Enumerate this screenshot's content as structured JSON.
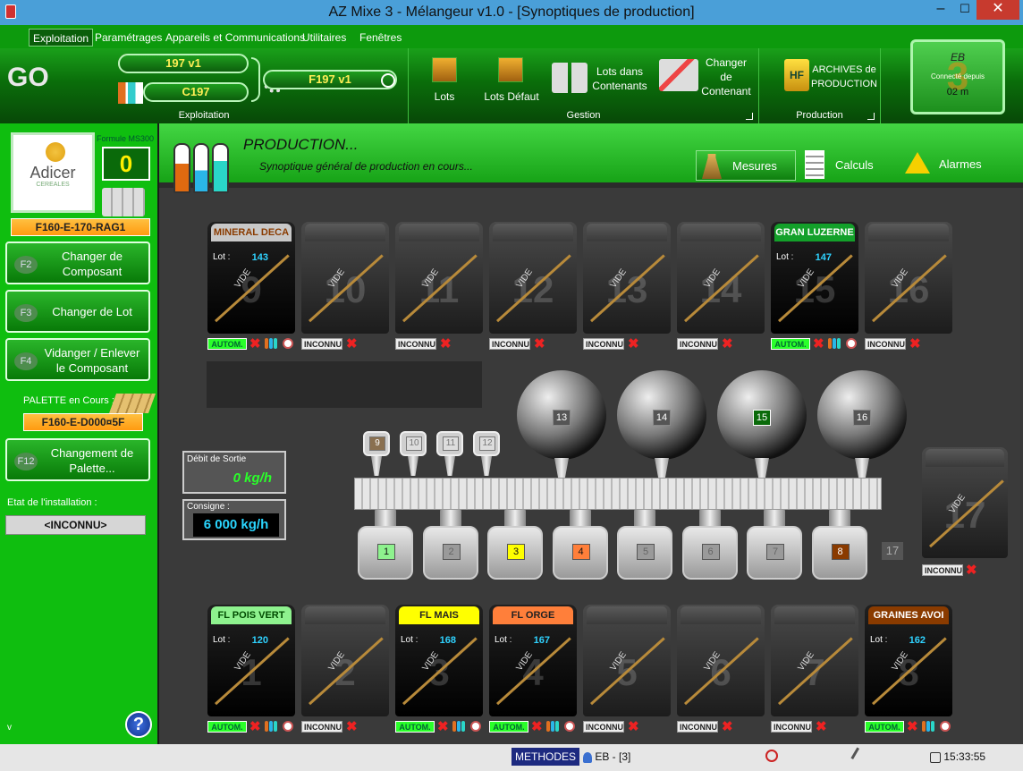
{
  "window": {
    "title": "AZ Mixe 3 -  Mélangeur v1.0 - [Synoptiques de production]",
    "minimize": "–",
    "maximize": "☐",
    "close": "✕"
  },
  "menu": [
    "Exploitation",
    "Paramétrages",
    "Appareils et Communications",
    "Utilitaires",
    "Fenêtres"
  ],
  "ribbon": {
    "go": "GO",
    "pill1": "197 v1",
    "pill2": "C197",
    "pill3": "F197 v1",
    "exploitation_label": "Exploitation",
    "gestion_label": "Gestion",
    "production_label": "Production",
    "lots": "Lots",
    "lots_defaut": "Lots Défaut",
    "lots_contenants": "Lots dans\nContenants",
    "changer_contenant": "Changer\nde\nContenant",
    "archives": "ARCHIVES de\nPRODUCTION",
    "hf": "HF",
    "eb": "EB",
    "connecte": "Connecté depuis",
    "duree": "02 m",
    "eb_num": "3"
  },
  "sidebar": {
    "logo": "Adicer",
    "logo_sub": "CEREALES",
    "formule_label": "Formule MS300",
    "formule_value": "0",
    "recipe": "F160-E-170-RAG1",
    "f2_key": "F2",
    "f2": "Changer de Composant",
    "f3_key": "F3",
    "f3": "Changer de Lot",
    "f4_key": "F4",
    "f4": "Vidanger / Enlever le Composant",
    "palette_label": "PALETTE en Cours :",
    "palette_value": "F160-E-D000¤5F",
    "f12_key": "F12",
    "f12": "Changement de Palette...",
    "etat_label": "Etat de l'installation :",
    "etat_value": "<INCONNU>",
    "version": "v",
    "help": "?"
  },
  "header": {
    "title": "PRODUCTION...",
    "subtitle": "Synoptique général de production en cours...",
    "mesures": "Mesures",
    "calculs": "Calculs",
    "alarmes": "Alarmes"
  },
  "debit": {
    "label": "Débit de Sortie",
    "value": "0 kg/h"
  },
  "consigne": {
    "label": "Consigne :",
    "value": "6 000 kg/h"
  },
  "top_silos": [
    {
      "num": "9",
      "name": "MINERAL DECA",
      "cap": "#c8c8c8",
      "capfg": "#8a3b00",
      "lot": "143",
      "status": "AUTOM."
    },
    {
      "num": "10",
      "name": "",
      "lot": "",
      "status": "INCONNU"
    },
    {
      "num": "11",
      "name": "",
      "lot": "",
      "status": "INCONNU"
    },
    {
      "num": "12",
      "name": "",
      "lot": "",
      "status": "INCONNU"
    },
    {
      "num": "13",
      "name": "",
      "lot": "",
      "status": "INCONNU"
    },
    {
      "num": "14",
      "name": "",
      "lot": "",
      "status": "INCONNU"
    },
    {
      "num": "15",
      "name": "GRAN LUZERNE",
      "cap": "#13a02a",
      "capfg": "#ffffff",
      "lot": "147",
      "status": "AUTOM."
    },
    {
      "num": "16",
      "name": "",
      "lot": "",
      "status": "INCONNU"
    }
  ],
  "bottom_silos": [
    {
      "num": "1",
      "name": "FL POIS VERT",
      "cap": "#8ef28e",
      "capfg": "#004a00",
      "lot": "120",
      "status": "AUTOM."
    },
    {
      "num": "2",
      "name": "",
      "lot": "",
      "status": "INCONNU"
    },
    {
      "num": "3",
      "name": "FL MAIS",
      "cap": "#ffff00",
      "capfg": "#222222",
      "lot": "168",
      "status": "AUTOM."
    },
    {
      "num": "4",
      "name": "FL ORGE",
      "cap": "#ff7f3a",
      "capfg": "#222222",
      "lot": "167",
      "status": "AUTOM."
    },
    {
      "num": "5",
      "name": "",
      "lot": "",
      "status": "INCONNU"
    },
    {
      "num": "6",
      "name": "",
      "lot": "",
      "status": "INCONNU"
    },
    {
      "num": "7",
      "name": "",
      "lot": "",
      "status": "INCONNU"
    },
    {
      "num": "8",
      "name": "GRAINES AVOI",
      "cap": "#8a3b00",
      "capfg": "#ffffff",
      "lot": "162",
      "status": "AUTOM."
    }
  ],
  "silo17": {
    "num": "17",
    "status": "INCONNU",
    "tag": "17"
  },
  "vide": "VIDE",
  "lot_label": "Lot :",
  "small_hoppers": [
    "9",
    "10",
    "11",
    "12"
  ],
  "balls": [
    "13",
    "14",
    "15",
    "16"
  ],
  "mixers": [
    {
      "n": "1",
      "c": "#8ef28e"
    },
    {
      "n": "2",
      "c": "#9a9a9a"
    },
    {
      "n": "3",
      "c": "#ffff00"
    },
    {
      "n": "4",
      "c": "#ff7f3a"
    },
    {
      "n": "5",
      "c": "#9a9a9a"
    },
    {
      "n": "6",
      "c": "#9a9a9a"
    },
    {
      "n": "7",
      "c": "#9a9a9a"
    },
    {
      "n": "8",
      "c": "#8a3b00"
    }
  ],
  "status": {
    "methodes": "METHODES",
    "user": "EB - [3]",
    "time": "15:33:55"
  }
}
